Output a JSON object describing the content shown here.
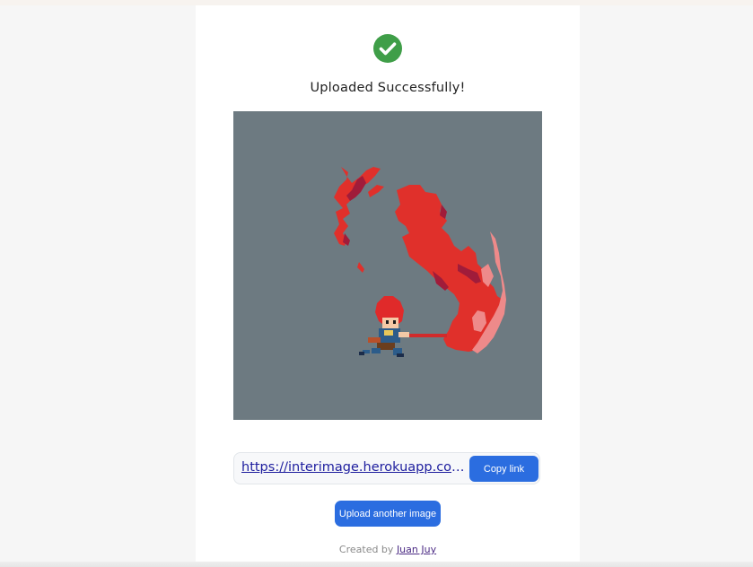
{
  "status": {
    "icon": "check-circle-icon",
    "icon_color": "#3f9e48",
    "title": "Uploaded Successfully!"
  },
  "image": {
    "background": "#6d7a81",
    "description_icon": "uploaded-image"
  },
  "link": {
    "url_text": "https://interimage.herokuapp.com/...",
    "copy_label": "Copy link"
  },
  "actions": {
    "upload_another_label": "Upload another image"
  },
  "footer": {
    "prefix": "Created by",
    "author": "Juan Juy"
  },
  "colors": {
    "accent": "#2b6de0",
    "page_bg": "#f6f6f6",
    "card_bg": "#ffffff"
  }
}
